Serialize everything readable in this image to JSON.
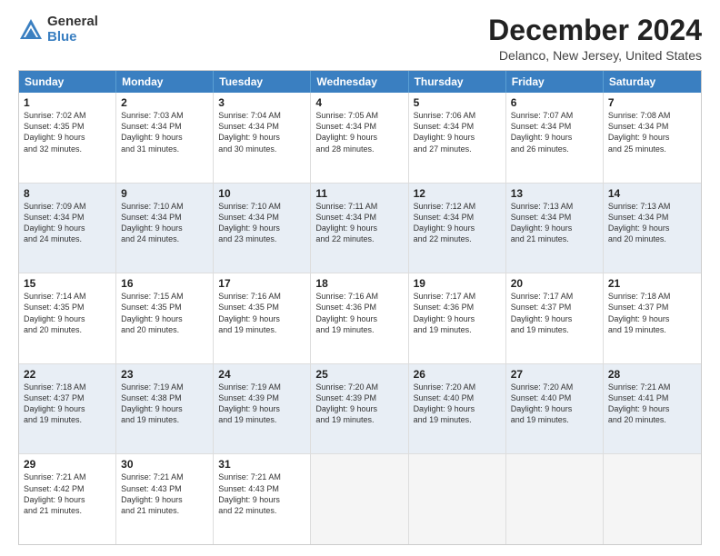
{
  "logo": {
    "general": "General",
    "blue": "Blue"
  },
  "title": "December 2024",
  "location": "Delanco, New Jersey, United States",
  "days_of_week": [
    "Sunday",
    "Monday",
    "Tuesday",
    "Wednesday",
    "Thursday",
    "Friday",
    "Saturday"
  ],
  "weeks": [
    [
      {
        "day": "1",
        "text": "Sunrise: 7:02 AM\nSunset: 4:35 PM\nDaylight: 9 hours\nand 32 minutes."
      },
      {
        "day": "2",
        "text": "Sunrise: 7:03 AM\nSunset: 4:34 PM\nDaylight: 9 hours\nand 31 minutes."
      },
      {
        "day": "3",
        "text": "Sunrise: 7:04 AM\nSunset: 4:34 PM\nDaylight: 9 hours\nand 30 minutes."
      },
      {
        "day": "4",
        "text": "Sunrise: 7:05 AM\nSunset: 4:34 PM\nDaylight: 9 hours\nand 28 minutes."
      },
      {
        "day": "5",
        "text": "Sunrise: 7:06 AM\nSunset: 4:34 PM\nDaylight: 9 hours\nand 27 minutes."
      },
      {
        "day": "6",
        "text": "Sunrise: 7:07 AM\nSunset: 4:34 PM\nDaylight: 9 hours\nand 26 minutes."
      },
      {
        "day": "7",
        "text": "Sunrise: 7:08 AM\nSunset: 4:34 PM\nDaylight: 9 hours\nand 25 minutes."
      }
    ],
    [
      {
        "day": "8",
        "text": "Sunrise: 7:09 AM\nSunset: 4:34 PM\nDaylight: 9 hours\nand 24 minutes."
      },
      {
        "day": "9",
        "text": "Sunrise: 7:10 AM\nSunset: 4:34 PM\nDaylight: 9 hours\nand 24 minutes."
      },
      {
        "day": "10",
        "text": "Sunrise: 7:10 AM\nSunset: 4:34 PM\nDaylight: 9 hours\nand 23 minutes."
      },
      {
        "day": "11",
        "text": "Sunrise: 7:11 AM\nSunset: 4:34 PM\nDaylight: 9 hours\nand 22 minutes."
      },
      {
        "day": "12",
        "text": "Sunrise: 7:12 AM\nSunset: 4:34 PM\nDaylight: 9 hours\nand 22 minutes."
      },
      {
        "day": "13",
        "text": "Sunrise: 7:13 AM\nSunset: 4:34 PM\nDaylight: 9 hours\nand 21 minutes."
      },
      {
        "day": "14",
        "text": "Sunrise: 7:13 AM\nSunset: 4:34 PM\nDaylight: 9 hours\nand 20 minutes."
      }
    ],
    [
      {
        "day": "15",
        "text": "Sunrise: 7:14 AM\nSunset: 4:35 PM\nDaylight: 9 hours\nand 20 minutes."
      },
      {
        "day": "16",
        "text": "Sunrise: 7:15 AM\nSunset: 4:35 PM\nDaylight: 9 hours\nand 20 minutes."
      },
      {
        "day": "17",
        "text": "Sunrise: 7:16 AM\nSunset: 4:35 PM\nDaylight: 9 hours\nand 19 minutes."
      },
      {
        "day": "18",
        "text": "Sunrise: 7:16 AM\nSunset: 4:36 PM\nDaylight: 9 hours\nand 19 minutes."
      },
      {
        "day": "19",
        "text": "Sunrise: 7:17 AM\nSunset: 4:36 PM\nDaylight: 9 hours\nand 19 minutes."
      },
      {
        "day": "20",
        "text": "Sunrise: 7:17 AM\nSunset: 4:37 PM\nDaylight: 9 hours\nand 19 minutes."
      },
      {
        "day": "21",
        "text": "Sunrise: 7:18 AM\nSunset: 4:37 PM\nDaylight: 9 hours\nand 19 minutes."
      }
    ],
    [
      {
        "day": "22",
        "text": "Sunrise: 7:18 AM\nSunset: 4:37 PM\nDaylight: 9 hours\nand 19 minutes."
      },
      {
        "day": "23",
        "text": "Sunrise: 7:19 AM\nSunset: 4:38 PM\nDaylight: 9 hours\nand 19 minutes."
      },
      {
        "day": "24",
        "text": "Sunrise: 7:19 AM\nSunset: 4:39 PM\nDaylight: 9 hours\nand 19 minutes."
      },
      {
        "day": "25",
        "text": "Sunrise: 7:20 AM\nSunset: 4:39 PM\nDaylight: 9 hours\nand 19 minutes."
      },
      {
        "day": "26",
        "text": "Sunrise: 7:20 AM\nSunset: 4:40 PM\nDaylight: 9 hours\nand 19 minutes."
      },
      {
        "day": "27",
        "text": "Sunrise: 7:20 AM\nSunset: 4:40 PM\nDaylight: 9 hours\nand 19 minutes."
      },
      {
        "day": "28",
        "text": "Sunrise: 7:21 AM\nSunset: 4:41 PM\nDaylight: 9 hours\nand 20 minutes."
      }
    ],
    [
      {
        "day": "29",
        "text": "Sunrise: 7:21 AM\nSunset: 4:42 PM\nDaylight: 9 hours\nand 21 minutes."
      },
      {
        "day": "30",
        "text": "Sunrise: 7:21 AM\nSunset: 4:43 PM\nDaylight: 9 hours\nand 21 minutes."
      },
      {
        "day": "31",
        "text": "Sunrise: 7:21 AM\nSunset: 4:43 PM\nDaylight: 9 hours\nand 22 minutes."
      },
      {
        "day": "",
        "text": ""
      },
      {
        "day": "",
        "text": ""
      },
      {
        "day": "",
        "text": ""
      },
      {
        "day": "",
        "text": ""
      }
    ]
  ]
}
